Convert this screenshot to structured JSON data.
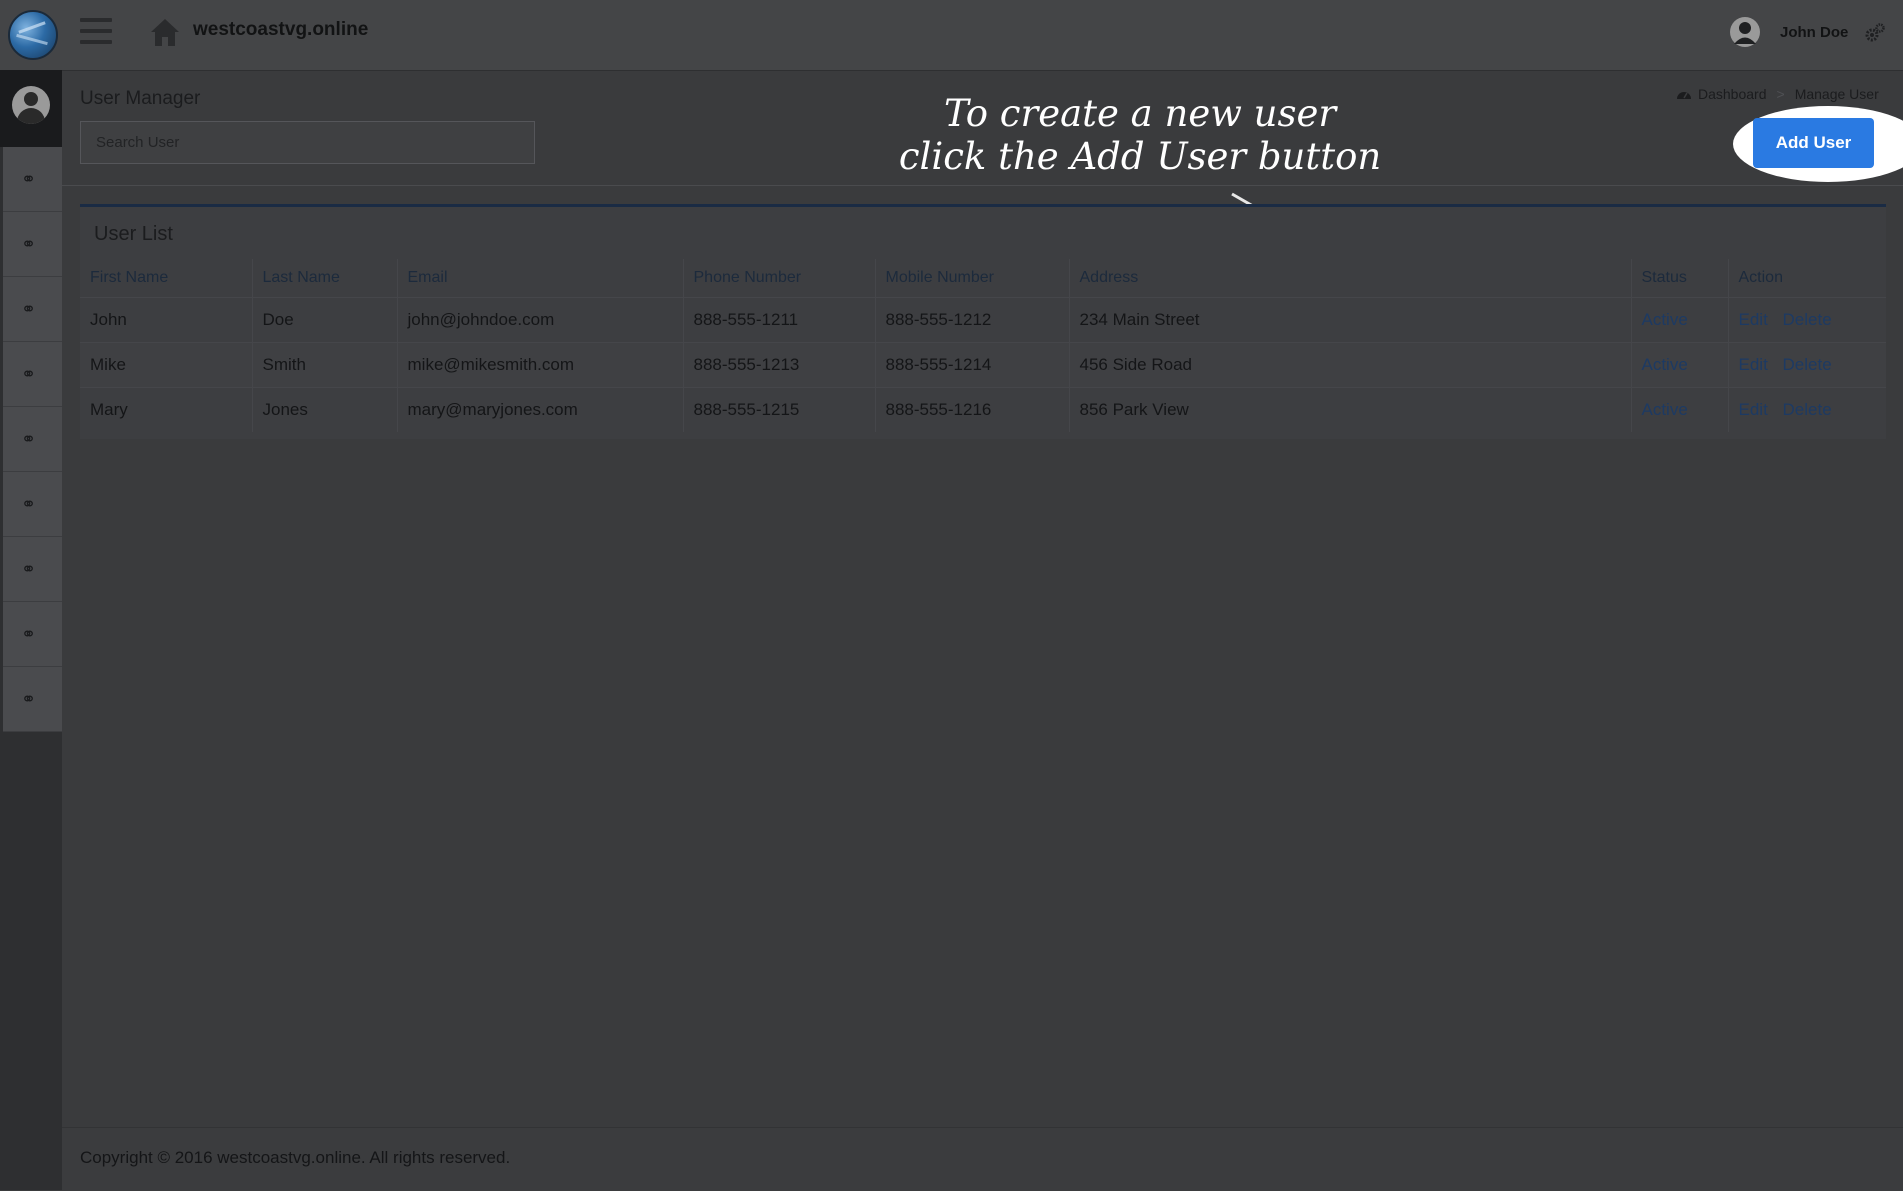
{
  "header": {
    "site_name": "westcoastvg.online",
    "user_name": "John Doe"
  },
  "page": {
    "title": "User Manager",
    "search_placeholder": "Search User",
    "breadcrumb": [
      "Dashboard",
      "Manage User"
    ],
    "breadcrumb_separator": ">",
    "add_user_label": "Add User",
    "annotation_line1": "To create a new user",
    "annotation_line2": "click the Add User button"
  },
  "sidebar": {
    "items": [
      {
        "icon": "link-icon"
      },
      {
        "icon": "link-icon"
      },
      {
        "icon": "link-icon"
      },
      {
        "icon": "link-icon"
      },
      {
        "icon": "link-icon"
      },
      {
        "icon": "link-icon"
      },
      {
        "icon": "link-icon"
      },
      {
        "icon": "link-icon"
      },
      {
        "icon": "link-icon"
      }
    ]
  },
  "table": {
    "title": "User List",
    "columns": [
      "First Name",
      "Last Name",
      "Email",
      "Phone Number",
      "Mobile Number",
      "Address",
      "Status",
      "Action"
    ],
    "rows": [
      {
        "first": "John",
        "last": "Doe",
        "email": "john@johndoe.com",
        "phone": "888-555-1211",
        "mobile": "888-555-1212",
        "address": "234 Main Street",
        "status": "Active"
      },
      {
        "first": "Mike",
        "last": "Smith",
        "email": "mike@mikesmith.com",
        "phone": "888-555-1213",
        "mobile": "888-555-1214",
        "address": "456 Side Road",
        "status": "Active"
      },
      {
        "first": "Mary",
        "last": "Jones",
        "email": "mary@maryjones.com",
        "phone": "888-555-1215",
        "mobile": "888-555-1216",
        "address": "856 Park View",
        "status": "Active"
      }
    ],
    "edit_label": "Edit",
    "delete_label": "Delete"
  },
  "footer": {
    "copyright": "Copyright © 2016 westcoastvg.online. All rights reserved."
  },
  "colors": {
    "accent": "#2a7ae2",
    "link": "#1d3a63",
    "background": "#3a3b3d"
  }
}
